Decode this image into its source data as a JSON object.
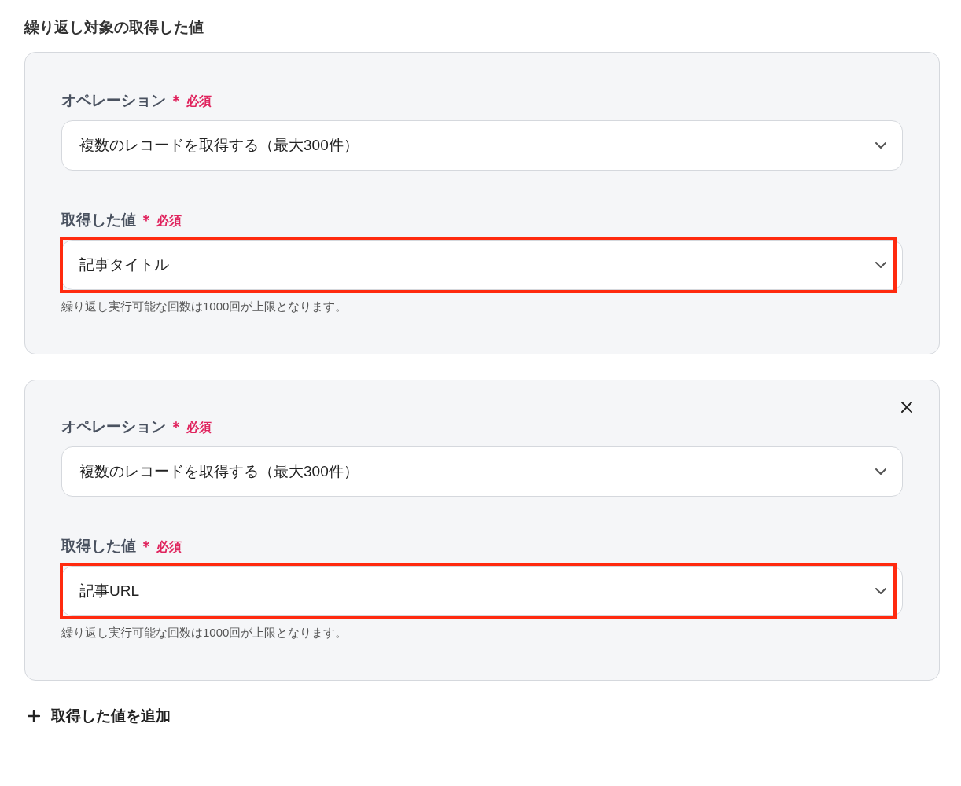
{
  "section_title": "繰り返し対象の取得した値",
  "cards": [
    {
      "closable": false,
      "fields": [
        {
          "label": "オペレーション",
          "required_mark": "＊",
          "required_text": "必須",
          "value": "複数のレコードを取得する（最大300件）",
          "highlighted": false
        },
        {
          "label": "取得した値",
          "required_mark": "＊",
          "required_text": "必須",
          "value": "記事タイトル",
          "highlighted": true,
          "hint": "繰り返し実行可能な回数は1000回が上限となります。"
        }
      ]
    },
    {
      "closable": true,
      "fields": [
        {
          "label": "オペレーション",
          "required_mark": "＊",
          "required_text": "必須",
          "value": "複数のレコードを取得する（最大300件）",
          "highlighted": false
        },
        {
          "label": "取得した値",
          "required_mark": "＊",
          "required_text": "必須",
          "value": "記事URL",
          "highlighted": true,
          "hint": "繰り返し実行可能な回数は1000回が上限となります。"
        }
      ]
    }
  ],
  "add_button": {
    "label": "取得した値を追加"
  }
}
